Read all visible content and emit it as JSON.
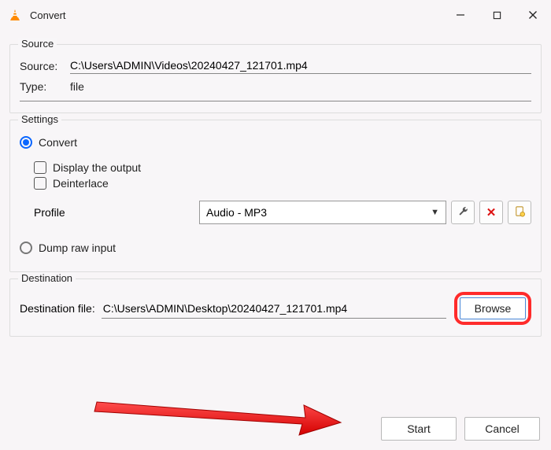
{
  "title": "Convert",
  "source_group": {
    "legend": "Source",
    "source_label": "Source:",
    "source_value": "C:\\Users\\ADMIN\\Videos\\20240427_121701.mp4",
    "type_label": "Type:",
    "type_value": "file"
  },
  "settings_group": {
    "legend": "Settings",
    "convert_radio": "Convert",
    "display_output": "Display the output",
    "deinterlace": "Deinterlace",
    "profile_label": "Profile",
    "profile_value": "Audio - MP3",
    "dump_radio": "Dump raw input"
  },
  "destination_group": {
    "legend": "Destination",
    "dest_label": "Destination file:",
    "dest_value": "C:\\Users\\ADMIN\\Desktop\\20240427_121701.mp4",
    "browse": "Browse"
  },
  "buttons": {
    "start": "Start",
    "cancel": "Cancel"
  }
}
